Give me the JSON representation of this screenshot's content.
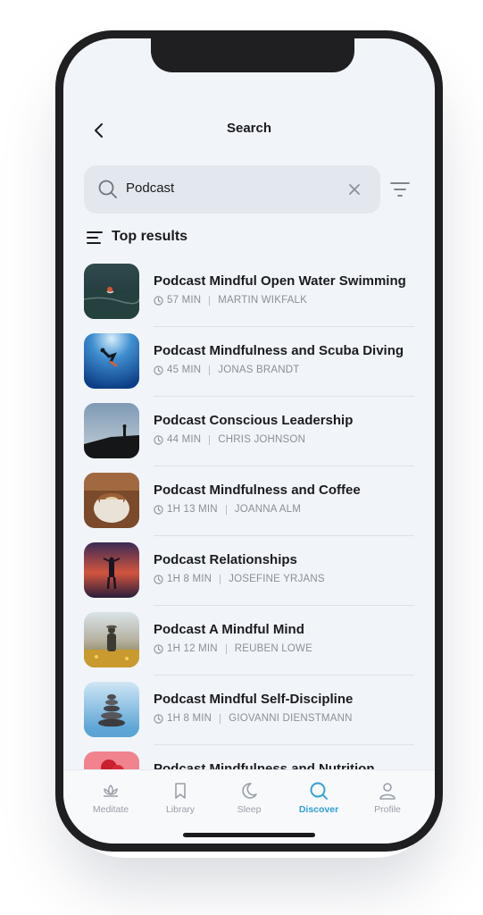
{
  "header": {
    "title": "Search"
  },
  "search": {
    "query": "Podcast"
  },
  "section": {
    "title": "Top results"
  },
  "results": [
    {
      "title": "Podcast Mindful Open Water Swimming",
      "duration": "57 MIN",
      "author": "MARTIN WIKFALK"
    },
    {
      "title": "Podcast Mindfulness and Scuba Diving",
      "duration": "45 MIN",
      "author": "JONAS BRANDT"
    },
    {
      "title": "Podcast Conscious Leadership",
      "duration": "44 MIN",
      "author": "CHRIS JOHNSON"
    },
    {
      "title": "Podcast Mindfulness and Coffee",
      "duration": "1H 13 MIN",
      "author": "JOANNA ALM"
    },
    {
      "title": "Podcast Relationships",
      "duration": "1H 8 MIN",
      "author": "JOSEFINE YRJANS"
    },
    {
      "title": "Podcast A Mindful Mind",
      "duration": "1H 12 MIN",
      "author": "REUBEN LOWE"
    },
    {
      "title": "Podcast Mindful Self-Discipline",
      "duration": "1H 8 MIN",
      "author": "GIOVANNI DIENSTMANN"
    },
    {
      "title": "Podcast Mindfulness and Nutrition",
      "duration": "",
      "author": ""
    }
  ],
  "tabs": [
    {
      "label": "Meditate",
      "icon": "lotus-icon"
    },
    {
      "label": "Library",
      "icon": "bookmark-icon"
    },
    {
      "label": "Sleep",
      "icon": "moon-icon"
    },
    {
      "label": "Discover",
      "icon": "search-icon",
      "active": true
    },
    {
      "label": "Profile",
      "icon": "person-icon"
    }
  ],
  "colors": {
    "accent": "#2f9fd6",
    "background": "#f1f5f9",
    "text": "#1b1b1f",
    "muted": "#8b8f98"
  }
}
